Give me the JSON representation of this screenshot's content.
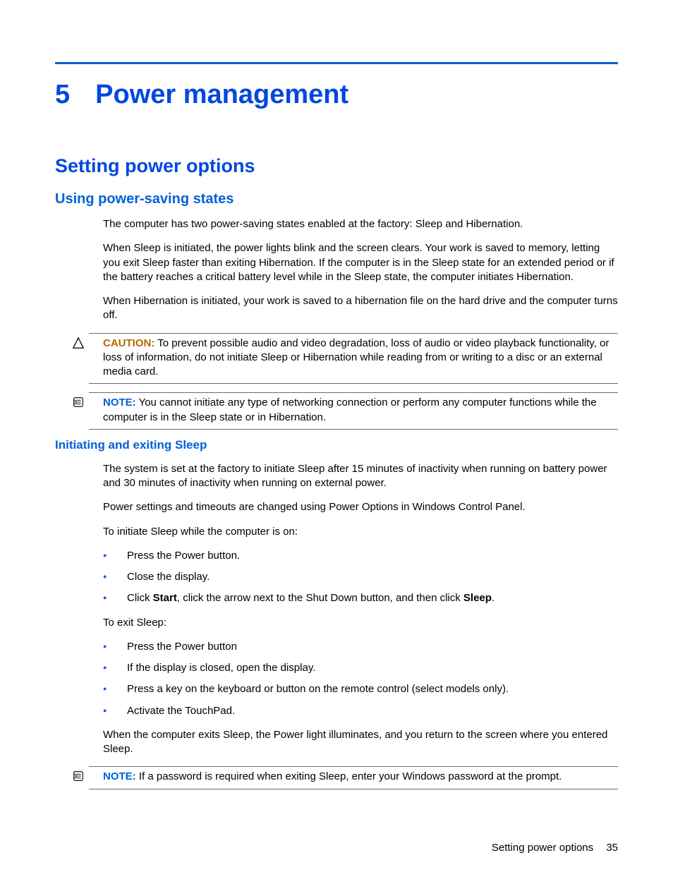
{
  "chapter": {
    "number": "5",
    "title": "Power management"
  },
  "h1": "Setting power options",
  "h2": "Using power-saving states",
  "p1": "The computer has two power-saving states enabled at the factory: Sleep and Hibernation.",
  "p2": "When Sleep is initiated, the power lights blink and the screen clears. Your work is saved to memory, letting you exit Sleep faster than exiting Hibernation. If the computer is in the Sleep state for an extended period or if the battery reaches a critical battery level while in the Sleep state, the computer initiates Hibernation.",
  "p3": "When Hibernation is initiated, your work is saved to a hibernation file on the hard drive and the computer turns off.",
  "caution1": {
    "label": "CAUTION:",
    "text": "To prevent possible audio and video degradation, loss of audio or video playback functionality, or loss of information, do not initiate Sleep or Hibernation while reading from or writing to a disc or an external media card."
  },
  "note1": {
    "label": "NOTE:",
    "text": "You cannot initiate any type of networking connection or perform any computer functions while the computer is in the Sleep state or in Hibernation."
  },
  "h3": "Initiating and exiting Sleep",
  "p4": "The system is set at the factory to initiate Sleep after 15 minutes of inactivity when running on battery power and 30 minutes of inactivity when running on external power.",
  "p5": "Power settings and timeouts are changed using Power Options in Windows Control Panel.",
  "p6": "To initiate Sleep while the computer is on:",
  "list1": {
    "i0": "Press the Power button.",
    "i1": "Close the display.",
    "i2_pre": "Click ",
    "i2_b1": "Start",
    "i2_mid": ", click the arrow next to the Shut Down button, and then click ",
    "i2_b2": "Sleep",
    "i2_post": "."
  },
  "p7": "To exit Sleep:",
  "list2": {
    "i0": "Press the Power button",
    "i1": "If the display is closed, open the display.",
    "i2": "Press a key on the keyboard or button on the remote control (select models only).",
    "i3": "Activate the TouchPad."
  },
  "p8": "When the computer exits Sleep, the Power light illuminates, and you return to the screen where you entered Sleep.",
  "note2": {
    "label": "NOTE:",
    "text": "If a password is required when exiting Sleep, enter your Windows password at the prompt."
  },
  "footer": {
    "title": "Setting power options",
    "page": "35"
  }
}
